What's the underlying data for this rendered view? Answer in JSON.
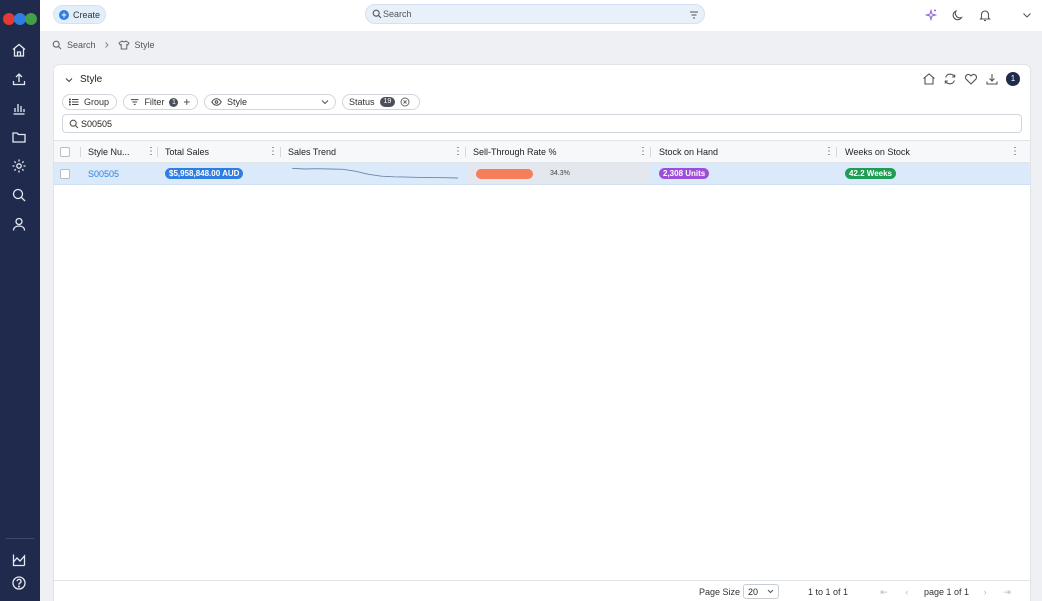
{
  "topbar": {
    "create_label": "Create",
    "search_placeholder": "Search",
    "icons": [
      "sparkle-icon",
      "moon-icon",
      "bell-icon",
      "chevron-down-icon"
    ]
  },
  "sidebar": {
    "logo_colors": [
      "#e53935",
      "#2f7de1",
      "#43a047"
    ],
    "items": [
      "home-icon",
      "upload-icon",
      "analytics-icon",
      "folder-icon",
      "settings-icon",
      "search-icon",
      "user-icon"
    ],
    "bottom_items": [
      "chart-icon",
      "help-icon"
    ]
  },
  "breadcrumb": {
    "items": [
      "Search",
      "Style"
    ]
  },
  "panel": {
    "title": "Style",
    "notification_count": "1",
    "chips": {
      "group_label": "Group",
      "filter_label": "Filter",
      "filter_count": "1",
      "style_label": "Style",
      "status_label": "Status",
      "status_count": "19"
    },
    "filter_value": "S00505"
  },
  "table": {
    "columns": [
      "Style Nu...",
      "Total Sales",
      "Sales Trend",
      "Sell-Through Rate %",
      "Stock on Hand",
      "Weeks on Stock"
    ],
    "rows": [
      {
        "style_number": "S00505",
        "total_sales": "$5,958,848.00 AUD",
        "sales_trend": [
          0.85,
          0.8,
          0.82,
          0.8,
          0.78,
          0.65,
          0.45,
          0.32,
          0.28,
          0.26,
          0.24,
          0.23,
          0.22,
          0.2
        ],
        "sell_through_label": "34.3%",
        "sell_through_value": 0.343,
        "stock_on_hand": "2,308 Units",
        "weeks_on_stock": "42.2 Weeks"
      }
    ]
  },
  "colors": {
    "total_sales_pill": "#2f7de1",
    "stock_pill": "#9c4fd8",
    "weeks_pill": "#1f9d55",
    "sell_through_fill": "#f47f5a",
    "sidebar_bg": "#1f2a4c"
  },
  "footer": {
    "page_size_label": "Page Size",
    "page_size_value": "20",
    "range_text": "1 to 1 of 1",
    "page_text": "page 1 of 1"
  }
}
